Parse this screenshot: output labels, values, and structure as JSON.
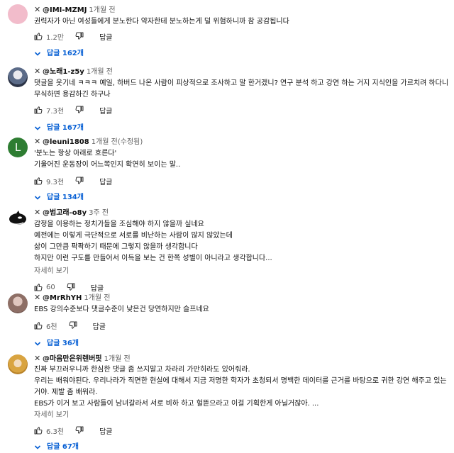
{
  "comments": [
    {
      "handle": "@IMI-MZMJ",
      "time": "1개월 전",
      "lines": [
        "권력자가 아닌 여성들에게 분노한다 약자한테 분노하는게 덜 위험하니까 참 공감됩니다"
      ],
      "likes": "1.2만",
      "reply_label": "답글",
      "replies": "답글 162개"
    },
    {
      "handle": "@노래1-z5y",
      "time": "1개월 전",
      "lines": [
        "댓글을 웃기네 ㅋㅋㅋ 예일, 하버드 나온 사람이 피상적으로 조사하고 말 한거겠니? 연구 분석 하고 강연 하는 거지 지식인을 가르치려 하다니 무식하면 용감하긴 하구나"
      ],
      "likes": "7.3천",
      "reply_label": "답글",
      "replies": "답글 167개"
    },
    {
      "handle": "@leuni1808",
      "time": "1개월 전(수정됨)",
      "lines": [
        "'분노는 항상 아래로 흐른다'",
        "기울어진 운동장이 어느쪽인지 확연히 보이는 말.."
      ],
      "likes": "9.3천",
      "reply_label": "답글",
      "replies": "답글 134개"
    },
    {
      "handle": "@범고래-o8y",
      "time": "3주 전",
      "lines": [
        "감정을 이용하는 정치가들을 조심해야 하지 않을까 싶네요",
        "예전에는 이렇게 극단적으로 서로를 비난하는 사람이 많지 않았는데",
        "삶이 그만큼 팍팍하기 때문에 그렇지 않을까 생각합니다",
        "하지만 이런 구도를 만들어서 이득을 보는 건 한쪽 성별이 아니라고 생각합니다..."
      ],
      "more": "자세히 보기",
      "likes": "60",
      "reply_label": "답글"
    },
    {
      "handle": "@MrRhYH",
      "time": "1개월 전",
      "lines": [
        "EBS 강의수준보다 댓글수준이 낮은건 당연하지만 슬프네요"
      ],
      "likes": "6천",
      "reply_label": "답글",
      "replies": "답글 36개"
    },
    {
      "handle": "@마음만은위렌버핏",
      "time": "1개월 전",
      "lines": [
        "진짜 부끄러우니까 한심한 댓글 좀 쓰지말고 차라리 가만히라도 있어줘라.",
        "우리는 배워야된다. 우리나라가 직면한 현실에 대해서 지금 저명한 학자가 초청되서 명백한 데이터를 근거를 바탕으로 귀한 강연 해주고 있는거야. 제발 좀 배워라.",
        "EBS가 이거 보고 사람들이 남녀갈라서 서로 비하 하고 헐뜯으라고 이걸 기획한게 아닐거잖아. ..."
      ],
      "more": "자세히 보기",
      "likes": "6.3천",
      "reply_label": "답글",
      "replies": "답글 67개"
    }
  ]
}
